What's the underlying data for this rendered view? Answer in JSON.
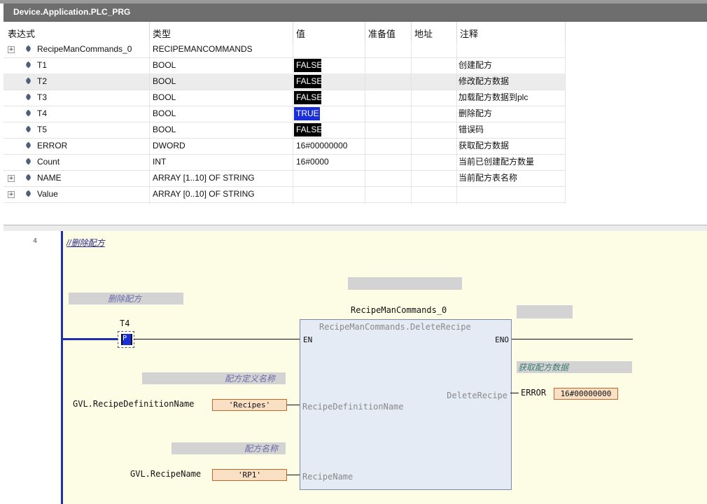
{
  "window": {
    "title": "Device.Application.PLC_PRG"
  },
  "watch": {
    "headers": {
      "expression": "表达式",
      "type": "类型",
      "value": "值",
      "prepared": "准备值",
      "address": "地址",
      "comment": "注释"
    },
    "rows": [
      {
        "expand": "+",
        "name": "RecipeManCommands_0",
        "type": "RECIPEMANCOMMANDS",
        "value": "",
        "comment": ""
      },
      {
        "expand": "",
        "name": "T1",
        "type": "BOOL",
        "value": "FALSE",
        "comment": "创建配方"
      },
      {
        "expand": "",
        "name": "T2",
        "type": "BOOL",
        "value": "FALSE",
        "comment": "修改配方数据"
      },
      {
        "expand": "",
        "name": "T3",
        "type": "BOOL",
        "value": "FALSE",
        "comment": "加载配方数据到plc"
      },
      {
        "expand": "",
        "name": "T4",
        "type": "BOOL",
        "value": "TRUE",
        "comment": "删除配方"
      },
      {
        "expand": "",
        "name": "T5",
        "type": "BOOL",
        "value": "FALSE",
        "comment": "错误码"
      },
      {
        "expand": "",
        "name": "ERROR",
        "type": "DWORD",
        "value": "16#00000000",
        "comment": "获取配方数据"
      },
      {
        "expand": "",
        "name": "Count",
        "type": "INT",
        "value": "16#0000",
        "comment": "当前已创建配方数量"
      },
      {
        "expand": "+",
        "name": "NAME",
        "type": "ARRAY [1..10] OF STRING",
        "value": "",
        "comment": "当前配方表名称"
      },
      {
        "expand": "+",
        "name": "Value",
        "type": "ARRAY [0..10] OF STRING",
        "value": "",
        "comment": ""
      }
    ]
  },
  "network": {
    "number": "4",
    "comment": "//删除配方",
    "contact_comment": "删除配方",
    "contact_var": "T4",
    "contact_glyph": "P",
    "fb_instance": "RecipeManCommands_0",
    "fb_type": "RecipeManCommands.DeleteRecipe",
    "pin_en": "EN",
    "pin_eno": "ENO",
    "pin_def": "RecipeDefinitionName",
    "pin_name": "RecipeName",
    "pin_out": "DeleteRecipe",
    "def_comment": "配方定义名称",
    "name_comment": "配方名称",
    "out_comment": "获取配方数据",
    "def_var": "GVL.RecipeDefinitionName",
    "def_value": "'Recipes'",
    "name_var": "GVL.RecipeName",
    "name_value": "'RP1'",
    "out_var": "ERROR",
    "out_value": "16#00000000"
  },
  "colors": {
    "true_bg": "#1b2fd9",
    "false_bg": "#000000",
    "titlebar": "#6e6e6e",
    "rail": "#1b2fb0",
    "editor_bg": "#fdfde6"
  }
}
